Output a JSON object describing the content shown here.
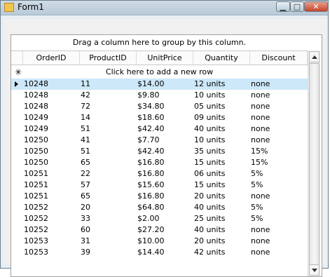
{
  "window": {
    "title": "Form1",
    "controls": {
      "minimize": "▁",
      "maximize": "□",
      "close": "✕"
    }
  },
  "grid": {
    "group_panel_text": "Drag a column here to group by this column.",
    "columns": [
      "OrderID",
      "ProductID",
      "UnitPrice",
      "Quantity",
      "Discount"
    ],
    "new_row_star": "✳",
    "new_row_text": "Click here to add a new row",
    "rows": [
      [
        "10248",
        "11",
        "$14.00",
        "12 units",
        "none"
      ],
      [
        "10248",
        "42",
        "$9.80",
        "10 units",
        "none"
      ],
      [
        "10248",
        "72",
        "$34.80",
        "05 units",
        "none"
      ],
      [
        "10249",
        "14",
        "$18.60",
        "09 units",
        "none"
      ],
      [
        "10249",
        "51",
        "$42.40",
        "40 units",
        "none"
      ],
      [
        "10250",
        "41",
        "$7.70",
        "10 units",
        "none"
      ],
      [
        "10250",
        "51",
        "$42.40",
        "35 units",
        "15%"
      ],
      [
        "10250",
        "65",
        "$16.80",
        "15 units",
        "15%"
      ],
      [
        "10251",
        "22",
        "$16.80",
        "06 units",
        "5%"
      ],
      [
        "10251",
        "57",
        "$15.60",
        "15 units",
        "5%"
      ],
      [
        "10251",
        "65",
        "$16.80",
        "20 units",
        "none"
      ],
      [
        "10252",
        "20",
        "$64.80",
        "40 units",
        "5%"
      ],
      [
        "10252",
        "33",
        "$2.00",
        "25 units",
        "5%"
      ],
      [
        "10252",
        "60",
        "$27.20",
        "40 units",
        "none"
      ],
      [
        "10253",
        "31",
        "$10.00",
        "20 units",
        "none"
      ],
      [
        "10253",
        "39",
        "$14.40",
        "42 units",
        "none"
      ]
    ],
    "selected_row_index": 0
  }
}
